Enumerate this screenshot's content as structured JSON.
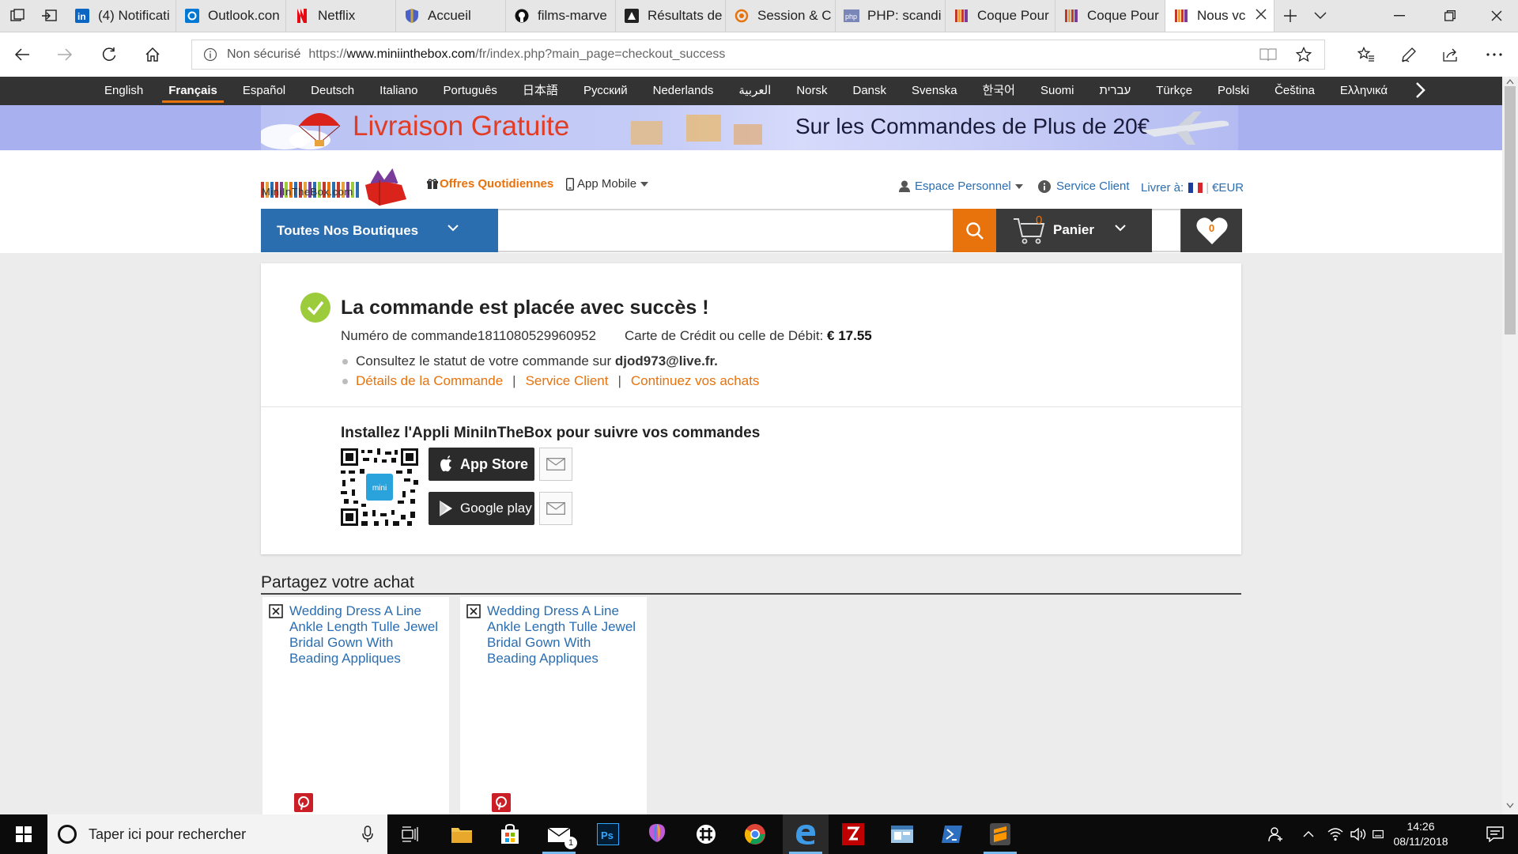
{
  "browser": {
    "tabs": [
      {
        "label": "(4) Notificati",
        "icon": "linkedin-icon",
        "color": "#0a66c2"
      },
      {
        "label": "Outlook.con",
        "icon": "outlook-icon",
        "color": "#0078d4"
      },
      {
        "label": "Netflix",
        "icon": "netflix-icon",
        "color": "#e50914"
      },
      {
        "label": "Accueil",
        "icon": "shield-icon",
        "color": "#4b61c8"
      },
      {
        "label": "films-marve",
        "icon": "github-icon",
        "color": "#111111"
      },
      {
        "label": "Résultats de",
        "icon": "resultats-icon",
        "color": "#222222"
      },
      {
        "label": "Session & C",
        "icon": "session-icon",
        "color": "#e8720c"
      },
      {
        "label": "PHP: scandi",
        "icon": "php-icon",
        "color": "#7a86b8"
      },
      {
        "label": "Coque Pour",
        "icon": "miniinthebox-icon",
        "color": "#c0392b"
      },
      {
        "label": "Coque Pour",
        "icon": "miniinthebox-icon",
        "color": "#c0392b"
      },
      {
        "label": "Nous vc",
        "icon": "miniinthebox-icon",
        "color": "#c0392b",
        "active": true
      }
    ],
    "address": {
      "security_label": "Non sécurisé",
      "url_prefix": "https://",
      "url_domain": "www.miniinthebox.com",
      "url_path": "/fr/index.php?main_page=checkout_success"
    }
  },
  "site": {
    "languages": [
      "English",
      "Français",
      "Español",
      "Deutsch",
      "Italiano",
      "Português",
      "日本語",
      "Русский",
      "Nederlands",
      "العربية",
      "Norsk",
      "Dansk",
      "Svenska",
      "한국어",
      "Suomi",
      "עברית",
      "Türkçe",
      "Polski",
      "Čeština",
      "Ελληνικά"
    ],
    "active_language": "Français",
    "promo": {
      "left_text": "Livraison Gratuite",
      "right_text": "Sur les Commandes de Plus de 20€"
    },
    "header": {
      "logo_text": "MiniInTheBox.com",
      "deals_label": "Offres Quotidiennes",
      "app_mobile_label": "App Mobile",
      "account_label": "Espace Personnel",
      "service_label": "Service Client",
      "deliver_label": "Livrer à:",
      "currency_label": "€EUR",
      "all_shops_label": "Toutes Nos Boutiques",
      "search_placeholder": "",
      "cart_count": "0",
      "cart_label": "Panier",
      "wishlist_count": "0"
    },
    "success": {
      "title": "La commande est placée avec succès !",
      "order_label": "Numéro de commande",
      "order_number": "1811080529960952",
      "payment_label": "Carte de Crédit ou celle de Débit:",
      "amount": "€ 17.55",
      "status_text": "Consultez le statut de votre commande sur",
      "email": "djod973@live.fr.",
      "links": [
        "Détails de la Commande",
        "Service Client",
        "Continuez vos achats"
      ],
      "app_title": "Installez l'Appli MiniInTheBox pour suivre vos commandes",
      "app_store_label": "App Store",
      "google_play_label": "Google play",
      "qr_badge": "mini"
    },
    "share": {
      "title": "Partagez votre achat",
      "products": [
        {
          "title": "Wedding Dress A Line Ankle Length Tulle Jewel Bridal Gown With Beading Appliques"
        },
        {
          "title": "Wedding Dress A Line Ankle Length Tulle Jewel Bridal Gown With Beading Appliques"
        }
      ]
    }
  },
  "taskbar": {
    "search_placeholder": "Taper ici pour rechercher",
    "mail_badge": "1",
    "clock_time": "14:26",
    "clock_date": "08/11/2018"
  },
  "colors": {
    "accent_orange": "#e8720c",
    "brand_blue": "#2b6eb0",
    "success_green": "#9ccc3c"
  }
}
